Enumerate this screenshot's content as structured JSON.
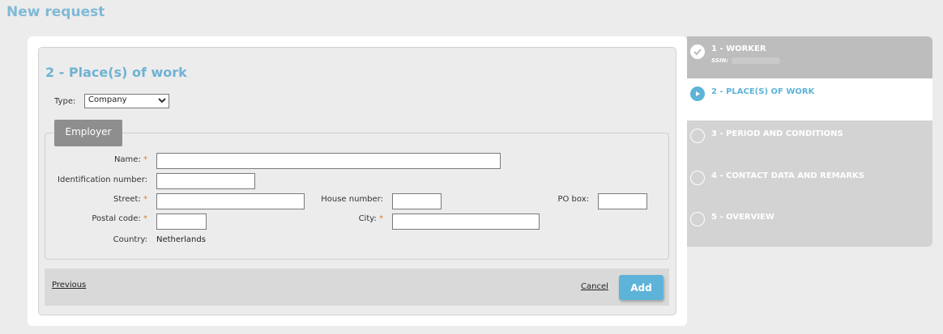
{
  "header": {
    "title": "New request"
  },
  "form": {
    "section_title": "2 - Place(s) of work",
    "type_label": "Type:",
    "type_value": "Company",
    "employer_tab": "Employer",
    "name_label": "Name:",
    "idnum_label": "Identification number:",
    "street_label": "Street:",
    "house_label": "House number:",
    "pobox_label": "PO box:",
    "postal_label": "Postal code:",
    "city_label": "City:",
    "country_label": "Country:",
    "country_value": "Netherlands",
    "required_mark": "*"
  },
  "footer": {
    "previous_label": "Previous",
    "cancel_label": "Cancel",
    "add_label": "Add"
  },
  "steps": [
    {
      "label": "1 - WORKER",
      "sub": "SSIN:",
      "state": "done"
    },
    {
      "label": "2 - PLACE(S) OF WORK",
      "state": "active"
    },
    {
      "label": "3 - PERIOD AND CONDITIONS",
      "state": "pending"
    },
    {
      "label": "4 - CONTACT DATA AND REMARKS",
      "state": "pending"
    },
    {
      "label": "5 - OVERVIEW",
      "state": "pending"
    }
  ],
  "colors": {
    "accent": "#6fb2d3",
    "required": "#e07a2a",
    "done_step_bg": "#bdbdbd",
    "pending_step_bg": "#d3d3d3",
    "active_step_bg": "#ffffff"
  }
}
